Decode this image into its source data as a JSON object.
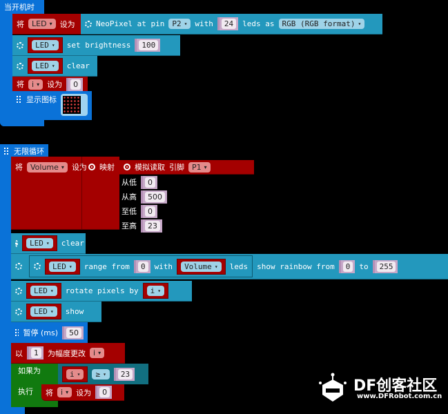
{
  "setup": {
    "title": "当开机时",
    "set": "将",
    "var_led": "LED",
    "set_to": "设为",
    "neopixel": "NeoPixel at pin",
    "pin": "P2",
    "with": "with",
    "leds_count": "24",
    "leds_as": "leds as",
    "format": "RGB (RGB format)",
    "brightness_label": "set brightness",
    "brightness": "100",
    "clear": "clear",
    "var_i": "i",
    "i_init": "0",
    "show_icon": "显示图标"
  },
  "loop": {
    "title": "无限循环",
    "set": "将",
    "var_volume": "Volume",
    "set_to": "设为",
    "map": "映射",
    "analog_read": "模拟读取",
    "pin_label": "引脚",
    "pin": "P1",
    "from_low": "从低",
    "from_low_val": "0",
    "from_high": "从高",
    "from_high_val": "500",
    "to_low": "至低",
    "to_low_val": "0",
    "to_high": "至高",
    "to_high_val": "23",
    "var_led": "LED",
    "clear": "clear",
    "range_from": "range from",
    "range_start": "0",
    "with": "with",
    "leds": "leds",
    "show_rainbow": "show rainbow from",
    "rainbow_from": "0",
    "to": "to",
    "rainbow_to": "255",
    "rotate": "rotate pixels by",
    "var_i": "i",
    "show": "show",
    "pause": "暂停 (ms)",
    "pause_val": "50",
    "change_by": "以",
    "change_val": "1",
    "change_label": "为幅度更改",
    "if": "如果为",
    "op": "≥",
    "compare_val": "23",
    "do": "执行",
    "reset_val": "0"
  },
  "logo": {
    "brand": "DF创客社区",
    "url": "www.DFRobot.com.cn"
  },
  "colors": {
    "event": "#0a72d8",
    "neopixel": "#2398bd",
    "variable": "#a40000",
    "logic": "#117a0f"
  }
}
